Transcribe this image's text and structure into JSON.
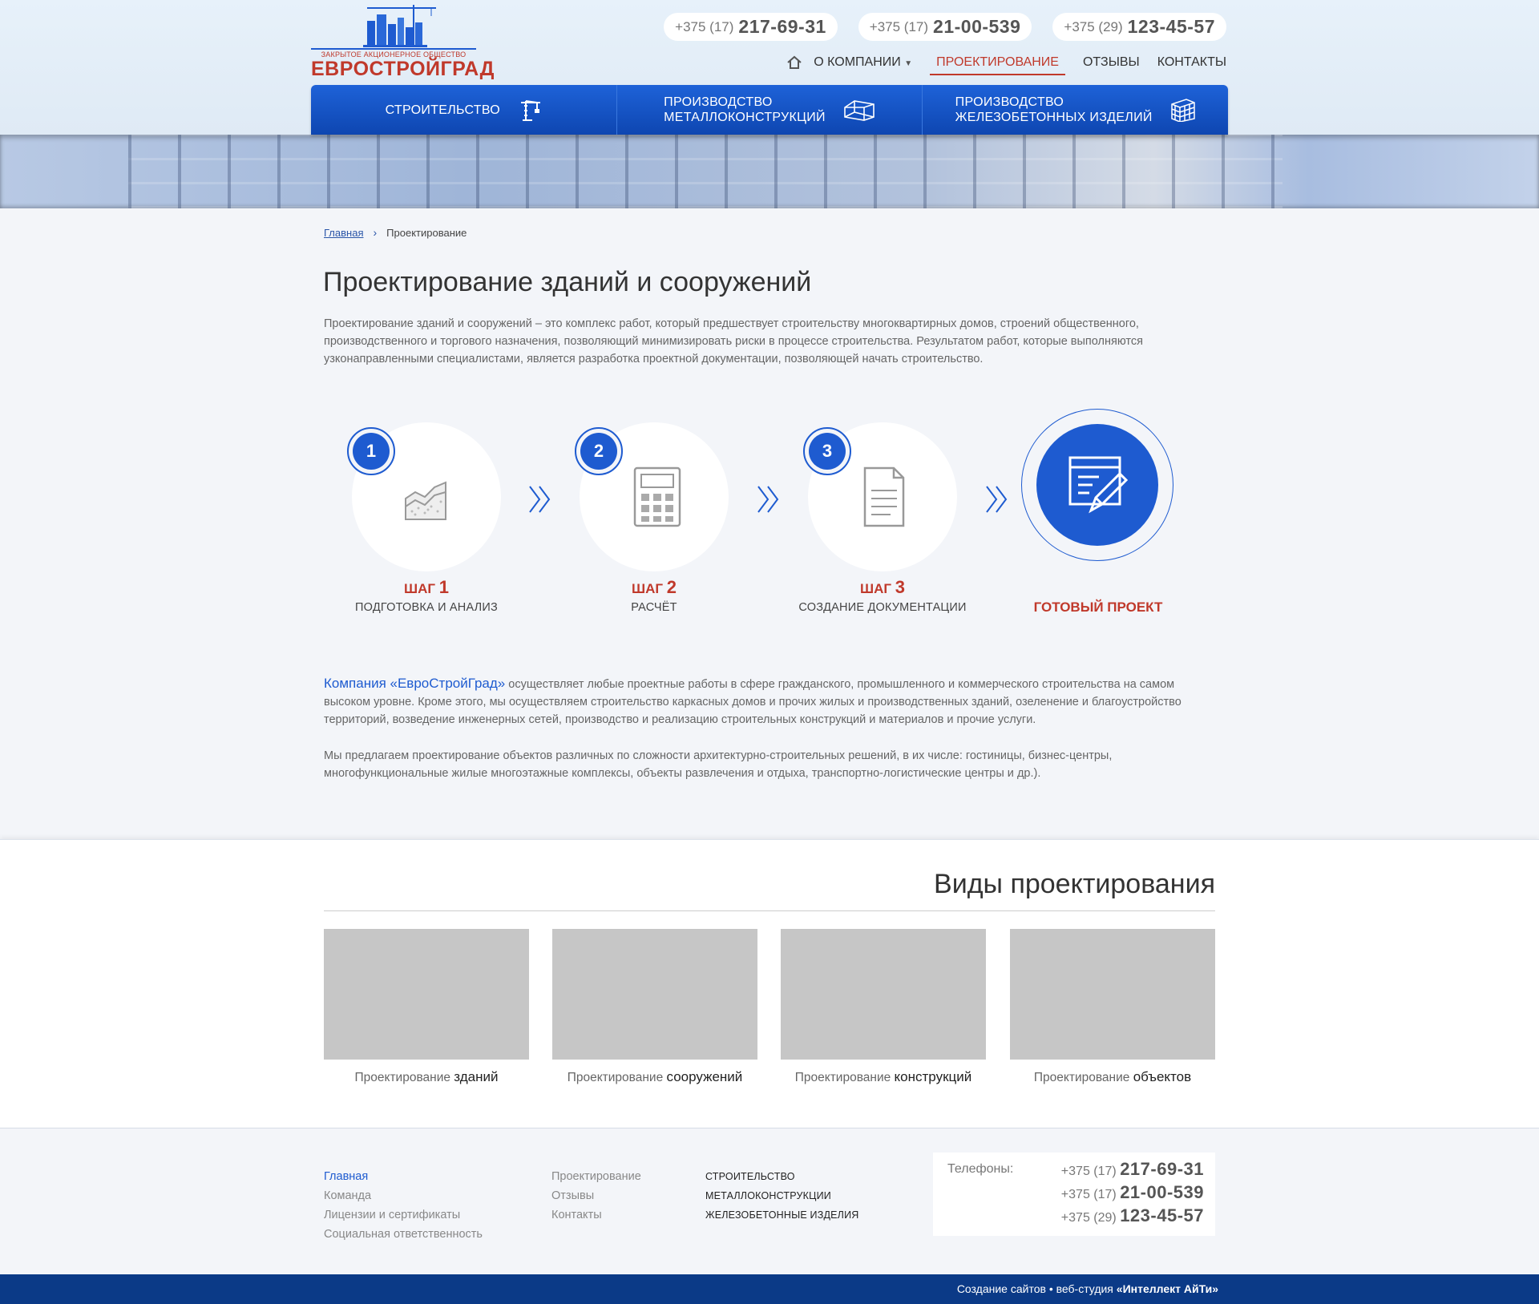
{
  "header": {
    "logo_sub": "ЗАКРЫТОЕ АКЦИОНЕРНОЕ ОБЩЕСТВО",
    "logo_name": "ЕВРОСТРОЙГРАД",
    "phones": [
      {
        "prefix": "+375 (17)",
        "number": "217-69-31"
      },
      {
        "prefix": "+375 (17)",
        "number": "21-00-539"
      },
      {
        "prefix": "+375 (29)",
        "number": "123-45-57"
      }
    ],
    "topnav": {
      "about": "О КОМПАНИИ",
      "design": "ПРОЕКТИРОВАНИЕ",
      "reviews": "ОТЗЫВЫ",
      "contacts": "КОНТАКТЫ"
    },
    "mainnav": [
      {
        "line1": "СТРОИТЕЛЬСТВО",
        "line2": ""
      },
      {
        "line1": "ПРОИЗВОДСТВО",
        "line2": "МЕТАЛЛОКОНСТРУКЦИЙ"
      },
      {
        "line1": "ПРОИЗВОДСТВО",
        "line2": "ЖЕЛЕЗОБЕТОННЫХ ИЗДЕЛИЙ"
      }
    ]
  },
  "breadcrumb": {
    "home": "Главная",
    "current": "Проектирование"
  },
  "page_title": "Проектирование зданий и сооружений",
  "intro": "Проектирование зданий и сооружений – это комплекс работ, который предшествует строительству многоквартирных домов, строений общественного, производственного и торгового назначения, позволяющий минимизировать риски в процессе строительства. Результатом работ, которые выполняются узконаправленными специалистами, является разработка проектной документации, позволяющей начать строительство.",
  "steps": [
    {
      "num": "1",
      "label": "ШАГ",
      "desc": "ПОДГОТОВКА И АНАЛИЗ",
      "icon": "chart-icon"
    },
    {
      "num": "2",
      "label": "ШАГ",
      "desc": "РАСЧЁТ",
      "icon": "calculator-icon"
    },
    {
      "num": "3",
      "label": "ШАГ",
      "desc": "СОЗДАНИЕ ДОКУМЕНТАЦИИ",
      "icon": "document-icon"
    }
  ],
  "final_step": "ГОТОВЫЙ ПРОЕКТ",
  "about": {
    "company": "Компания «ЕвроСтройГрад»",
    "text1": " осуществляет любые проектные работы в сфере гражданского, промышленного и коммерческого строительства на самом высоком уровне. Кроме этого, мы осуществляем строительство каркасных домов и прочих жилых и производственных зданий, озеленение и благоустройство территорий, возведение инженерных сетей, производство и реализацию строительных конструкций и материалов и прочие услуги.",
    "text2": "Мы предлагаем проектирование объектов  различных по сложности  архитектурно-строительных решений, в их числе: гостиницы, бизнес-центры, многофункциональные жилые многоэтажные комплексы, объекты развлечения и отдыха, транспортно-логистические центры и др.)."
  },
  "types": {
    "title": "Виды проектирования",
    "items": [
      {
        "prefix": "Проектирование",
        "word": "зданий"
      },
      {
        "prefix": "Проектирование",
        "word": "сооружений"
      },
      {
        "prefix": "Проектирование",
        "word": "конструкций"
      },
      {
        "prefix": "Проектирование",
        "word": "объектов"
      }
    ]
  },
  "footer": {
    "col1": [
      "Главная",
      "Команда",
      "Лицензии и сертификаты",
      "Социальная ответственность"
    ],
    "col2": [
      "Проектирование",
      "Отзывы",
      "Контакты"
    ],
    "col3": [
      "СТРОИТЕЛЬСТВО",
      "МЕТАЛЛОКОНСТРУКЦИИ",
      "ЖЕЛЕЗОБЕТОННЫЕ ИЗДЕЛИЯ"
    ],
    "phones_label": "Телефоны:",
    "credit_prefix": "Создание сайтов",
    "credit_mid": " веб-студия ",
    "credit_name": "«Интеллект АйТи»"
  },
  "colors": {
    "accent": "#1e5bd0",
    "brand_red": "#c0392b",
    "footer_bar": "#0b3a87"
  }
}
